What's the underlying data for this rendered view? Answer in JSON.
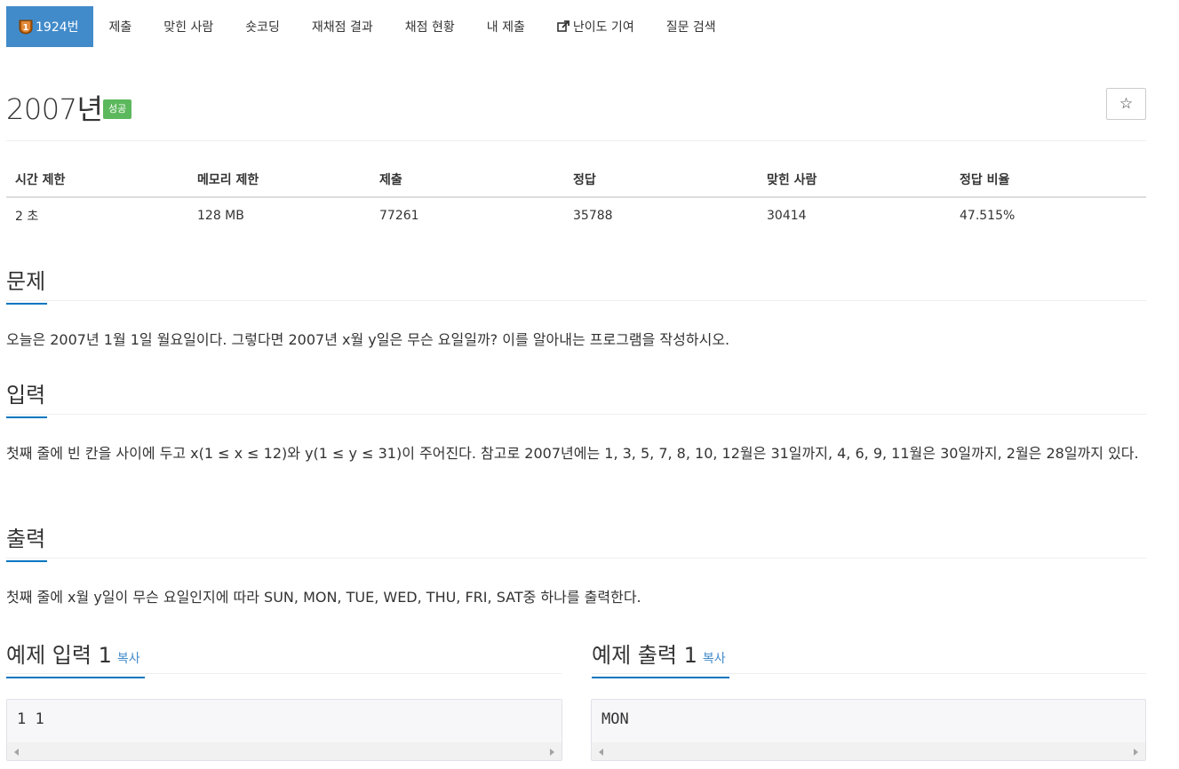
{
  "nav": {
    "problem_number": "1924번",
    "items": [
      "제출",
      "맞힌 사람",
      "숏코딩",
      "재채점 결과",
      "채점 현황",
      "내 제출",
      "난이도 기여",
      "질문 검색"
    ]
  },
  "problem": {
    "title": "2007년",
    "status_badge": "성공",
    "star_symbol": "☆"
  },
  "info_table": {
    "headers": [
      "시간 제한",
      "메모리 제한",
      "제출",
      "정답",
      "맞힌 사람",
      "정답 비율"
    ],
    "values": [
      "2 초",
      "128 MB",
      "77261",
      "35788",
      "30414",
      "47.515%"
    ]
  },
  "sections": {
    "description": {
      "title": "문제",
      "text": "오늘은 2007년 1월 1일 월요일이다. 그렇다면 2007년 x월 y일은 무슨 요일일까? 이를 알아내는 프로그램을 작성하시오."
    },
    "input": {
      "title": "입력",
      "text": "첫째 줄에 빈 칸을 사이에 두고 x(1 ≤ x ≤ 12)와 y(1 ≤ y ≤ 31)이 주어진다. 참고로 2007년에는 1, 3, 5, 7, 8, 10, 12월은 31일까지, 4, 6, 9, 11월은 30일까지, 2월은 28일까지 있다."
    },
    "output": {
      "title": "출력",
      "text": "첫째 줄에 x월 y일이 무슨 요일인지에 따라 SUN, MON, TUE, WED, THU, FRI, SAT중 하나를 출력한다."
    }
  },
  "samples": {
    "input_title": "예제 입력 1",
    "output_title": "예제 출력 1",
    "copy_label": "복사",
    "input_value": "1 1",
    "output_value": "MON"
  },
  "colors": {
    "active_tab": "#428bca",
    "success_badge": "#5cb85c",
    "section_accent": "#0076c0",
    "link": "#428bca"
  }
}
